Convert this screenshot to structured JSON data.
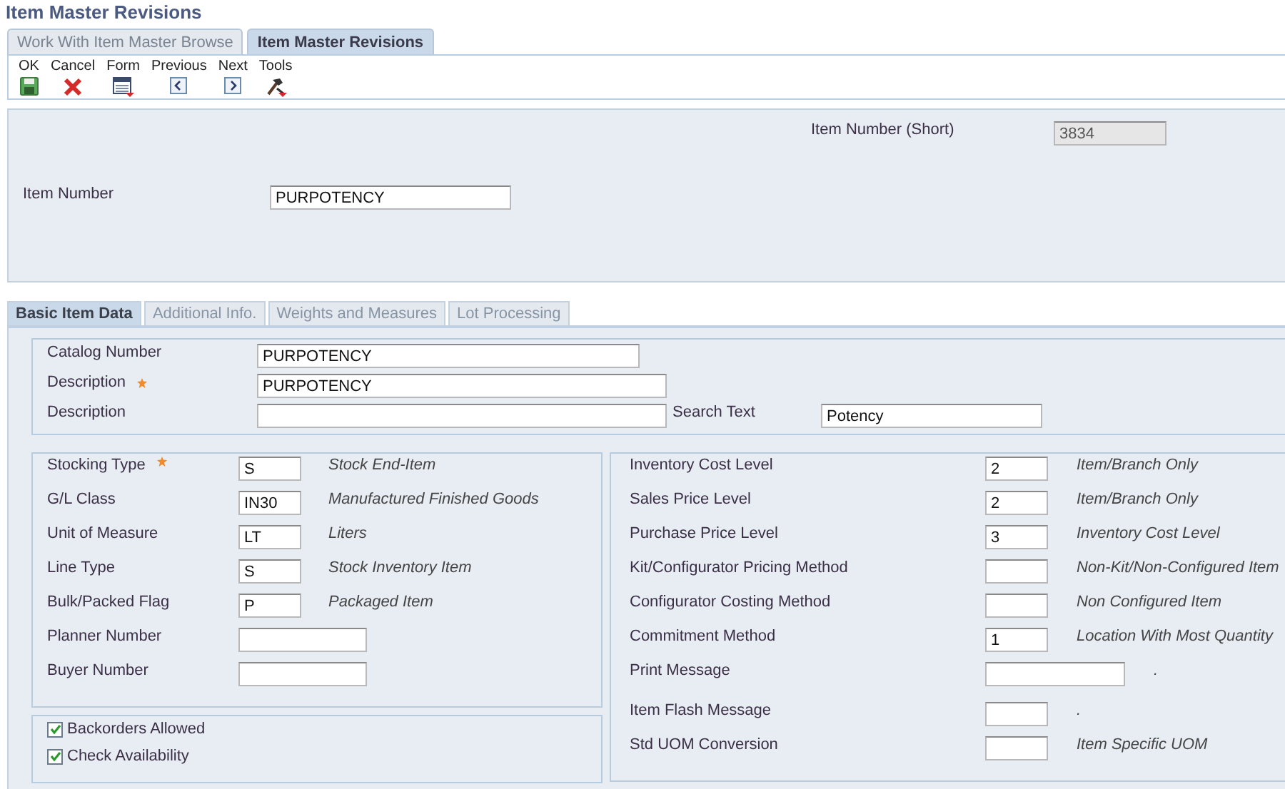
{
  "window": {
    "title": "Item Master Revisions"
  },
  "page_tabs": [
    {
      "label": "Work With Item Master Browse",
      "selected": false
    },
    {
      "label": "Item Master Revisions",
      "selected": true
    }
  ],
  "toolbar": [
    {
      "label": "OK",
      "kind": "save"
    },
    {
      "label": "Cancel",
      "kind": "cancel"
    },
    {
      "label": "Form",
      "kind": "form"
    },
    {
      "label": "Previous",
      "kind": "previous"
    },
    {
      "label": "Next",
      "kind": "next"
    },
    {
      "label": "Tools",
      "kind": "tools"
    }
  ],
  "header": {
    "short_item_number": {
      "label": "Item Number (Short)",
      "value": "3834",
      "read_only": true
    },
    "item_number": {
      "label": "Item Number",
      "value": "PURPOTENCY",
      "read_only": false
    }
  },
  "form_tabs": [
    {
      "label": "Basic Item Data",
      "selected": true
    },
    {
      "label": "Additional Info.",
      "selected": false
    },
    {
      "label": "Weights and Measures",
      "selected": false
    },
    {
      "label": "Lot Processing",
      "selected": false
    }
  ],
  "general": {
    "catalog_number": {
      "label": "Catalog Number",
      "value": "PURPOTENCY",
      "required": false
    },
    "description_1": {
      "label": "Description",
      "value": "PURPOTENCY",
      "required": true
    },
    "description_2": {
      "label": "Description",
      "required": false
    },
    "search_text": {
      "label": "Search Text",
      "value": "Potency"
    }
  },
  "left_fields": [
    {
      "label": "Stocking Type",
      "value": "S",
      "description": "Stock End-Item",
      "required": true,
      "kind": "short"
    },
    {
      "label": "G/L Class",
      "value": "IN30",
      "description": "Manufactured Finished Goods",
      "required": false,
      "kind": "short"
    },
    {
      "label": "Unit of Measure",
      "value": "LT",
      "description": "Liters",
      "required": false,
      "kind": "short"
    },
    {
      "label": "Line Type",
      "value": "S",
      "description": "Stock Inventory Item",
      "required": false,
      "kind": "short"
    },
    {
      "label": "Bulk/Packed Flag",
      "value": "P",
      "description": "Packaged Item",
      "required": false,
      "kind": "short"
    },
    {
      "label": "Planner Number",
      "required": false,
      "kind": "long"
    },
    {
      "label": "Buyer Number",
      "required": false,
      "kind": "long"
    }
  ],
  "checkboxes": [
    {
      "label": "Backorders Allowed",
      "checked": true
    },
    {
      "label": "Check Availability",
      "checked": true
    }
  ],
  "right_fields": [
    {
      "label": "Inventory Cost Level",
      "value": "2",
      "description": "Item/Branch Only",
      "kind": "short"
    },
    {
      "label": "Sales Price Level",
      "value": "2",
      "description": "Item/Branch Only",
      "kind": "short"
    },
    {
      "label": "Purchase Price Level",
      "value": "3",
      "description": "Inventory Cost Level",
      "kind": "short"
    },
    {
      "label": "Kit/Configurator Pricing Method",
      "description": "Non-Kit/Non-Configured Item",
      "kind": "short"
    },
    {
      "label": "Configurator Costing Method",
      "description": "Non Configured Item",
      "kind": "short"
    },
    {
      "label": "Commitment Method",
      "value": "1",
      "description": "Location With Most Quantity",
      "kind": "short"
    },
    {
      "label": "Print Message",
      "description": ".",
      "kind": "long"
    },
    {
      "label": "Item Flash Message",
      "description": ".",
      "kind": "short"
    },
    {
      "label": "Std UOM Conversion",
      "description": "Item Specific UOM",
      "kind": "short"
    }
  ]
}
